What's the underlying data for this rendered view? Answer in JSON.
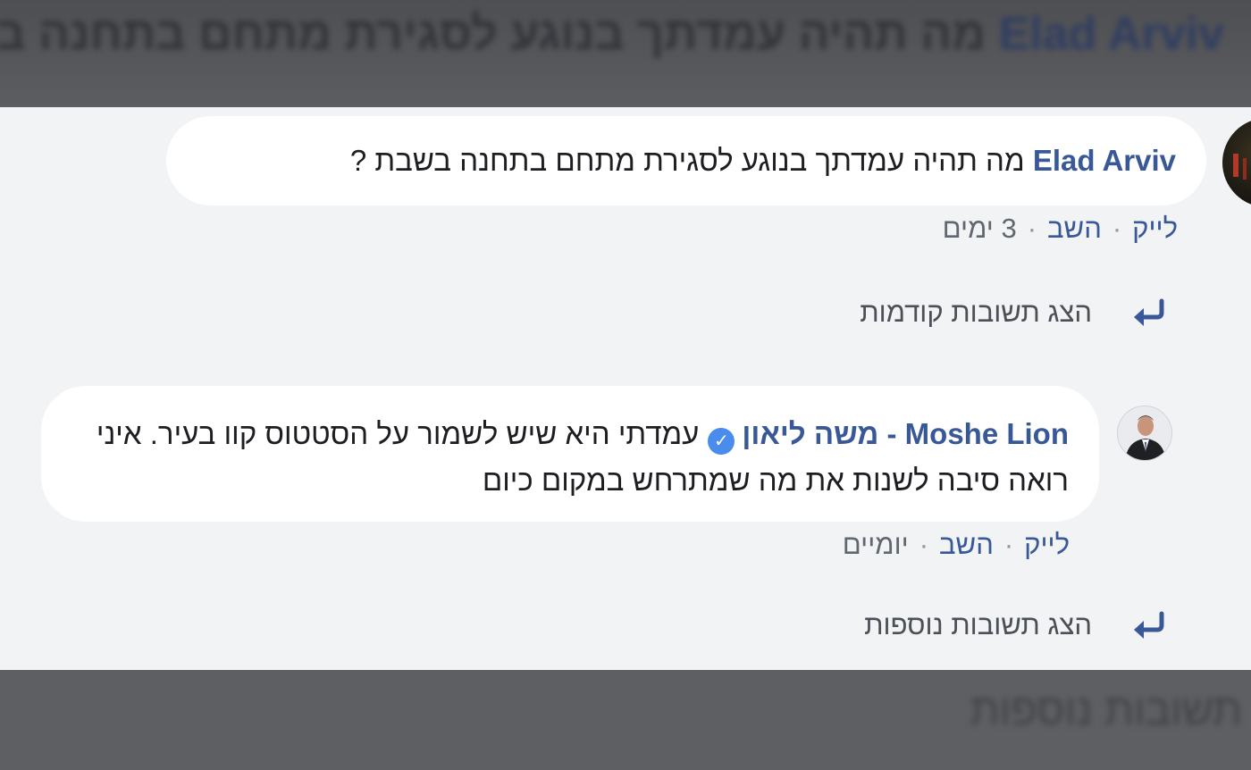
{
  "background_top": {
    "author": "Elad Arviv",
    "text": "מה תהיה עמדתך בנוגע לסגירת מתחם בתחנה בשבת ?"
  },
  "background_bottom": {
    "text": "תשובות נוספות"
  },
  "comments": [
    {
      "author": "Elad Arviv",
      "text": "מה תהיה עמדתך בנוגע לסגירת מתחם בתחנה בשבת ?",
      "like_label": "לייק",
      "reply_label": "השב",
      "time": "3 ימים",
      "separator": "·",
      "more_replies_label": "הצג תשובות קודמות"
    },
    {
      "author": "Moshe Lion - משה ליאון",
      "verified": "✓",
      "text": "עמדתי היא שיש לשמור על הסטטוס קוו בעיר. איני רואה סיבה לשנות את מה שמתרחש במקום כיום",
      "like_label": "לייק",
      "reply_label": "השב",
      "time": "יומיים",
      "separator": "·",
      "more_replies_label": "הצג תשובות נוספות"
    }
  ],
  "icons": {
    "reply_arrow": "reply-arrow-icon",
    "verified_badge": "verified-badge-icon",
    "avatar_1": "avatar",
    "avatar_2": "avatar"
  },
  "colors": {
    "author_link": "#385898",
    "bubble_bg": "#ffffff",
    "panel_bg": "#f2f3f5",
    "verified_badge": "#4a8bee",
    "overlay": "#5f6063"
  }
}
